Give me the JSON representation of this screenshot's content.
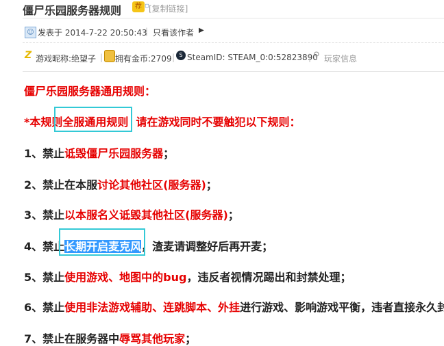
{
  "thread": {
    "title": "僵尸乐园服务器规则",
    "badge": "荐",
    "copy_link": "[复制链接]"
  },
  "meta": {
    "posted": "发表于 2014-7-22 20:50:43",
    "separator": "|",
    "author_only": "只看该作者"
  },
  "profile": {
    "nickname": "游戏昵称:绝望子",
    "coins": "拥有金币:2709",
    "steam_id": "SteamID: STEAM_0:0:52823890",
    "player_info": "玩家信息"
  },
  "content": {
    "heading": "僵尸乐园服务器通用规则：",
    "intro_prefix": "*本规",
    "intro_boxed": "则全服通用规则",
    "intro_suffix": "  请在游戏同时不要触犯以下规则：",
    "rules": [
      {
        "num": "1、禁止",
        "red": "诋毁僵尸乐园服务器",
        "tail": "；"
      },
      {
        "num": "2、禁止在本服",
        "red": "讨论其他社区(服务器)",
        "tail": "；"
      },
      {
        "num": "3、禁止",
        "red": "以本服名义诋毁其他社区(服务器)",
        "tail": "；"
      },
      {
        "num": "4、禁止",
        "red": "长期开启麦克风",
        "tail": "，渣麦请调整好后再开麦；"
      },
      {
        "num": "5、禁止",
        "red": "使用游戏、地图中的bug",
        "tail": "，违反者视情况踢出和封禁处理；"
      },
      {
        "num": "6、禁止",
        "red": "使用非法游戏辅助、连跳脚本、外挂",
        "tail": "进行游戏、影响游戏平衡，违者直接永久封"
      },
      {
        "num": "7、禁止在服务器中",
        "red": "辱骂其他玩家",
        "tail": "；"
      }
    ]
  }
}
